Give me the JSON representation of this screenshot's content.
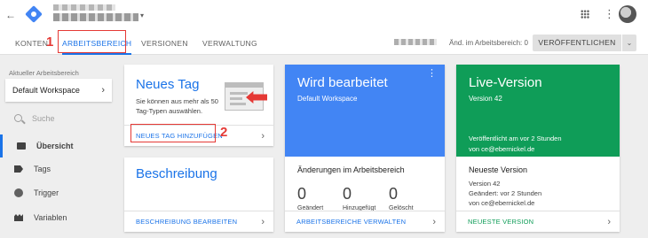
{
  "header": {
    "back_icon": "arrow-back-icon",
    "logo_icon": "gtm-diamond-icon",
    "account_caret": "▾",
    "apps_icon": "apps-grid-icon",
    "more_icon": "⋮"
  },
  "tabs": [
    {
      "label": "KONTEN"
    },
    {
      "label": "ARBEITSBEREICH"
    },
    {
      "label": "VERSIONEN"
    },
    {
      "label": "VERWALTUNG"
    }
  ],
  "annotations": [
    "1",
    "2"
  ],
  "workspace_bar": {
    "changes": "Änd. im Arbeitsbereich: 0",
    "publish_label": "VERÖFFENTLICHEN",
    "publish_caret": "⌄"
  },
  "sidebar": {
    "workspace_label": "Aktueller Arbeitsbereich",
    "workspace_value": "Default Workspace",
    "workspace_chevron": "›",
    "search_placeholder": "Suche",
    "items": [
      {
        "label": "Übersicht",
        "icon": "overview-icon"
      },
      {
        "label": "Tags",
        "icon": "tag-icon"
      },
      {
        "label": "Trigger",
        "icon": "trigger-icon"
      },
      {
        "label": "Variablen",
        "icon": "variables-icon"
      }
    ]
  },
  "new_tag_card": {
    "title": "Neues Tag",
    "description": "Sie können aus mehr als 50 Tag-Typen auswählen.",
    "link": "NEUES TAG HINZUFÜGEN",
    "chevron": "›"
  },
  "description_card": {
    "title": "Beschreibung",
    "link": "BESCHREIBUNG BEARBEITEN",
    "chevron": "›"
  },
  "workspace_card": {
    "title": "Wird bearbeitet",
    "subtitle": "Default Workspace",
    "menu": "⋮",
    "section_title": "Änderungen im Arbeitsbereich",
    "stats": [
      {
        "value": "0",
        "label": "Geändert"
      },
      {
        "value": "0",
        "label": "Hinzugefügt"
      },
      {
        "value": "0",
        "label": "Gelöscht"
      }
    ],
    "link": "ARBEITSBEREICHE VERWALTEN",
    "chevron": "›"
  },
  "live_card": {
    "title": "Live-Version",
    "subtitle": "Version 42",
    "published": "Veröffentlicht am vor 2 Stunden",
    "published_by": "von ce@ebernickel.de",
    "section_title": "Neueste Version",
    "version": "Version 42",
    "changed": "Geändert: vor 2 Stunden",
    "changed_by": "von ce@ebernickel.de",
    "link": "NEUESTE VERSION",
    "chevron": "›"
  },
  "colors": {
    "accent_blue": "#1a73e8",
    "card_blue": "#4285f4",
    "card_green": "#0f9d58",
    "annotation_red": "#e53935"
  }
}
